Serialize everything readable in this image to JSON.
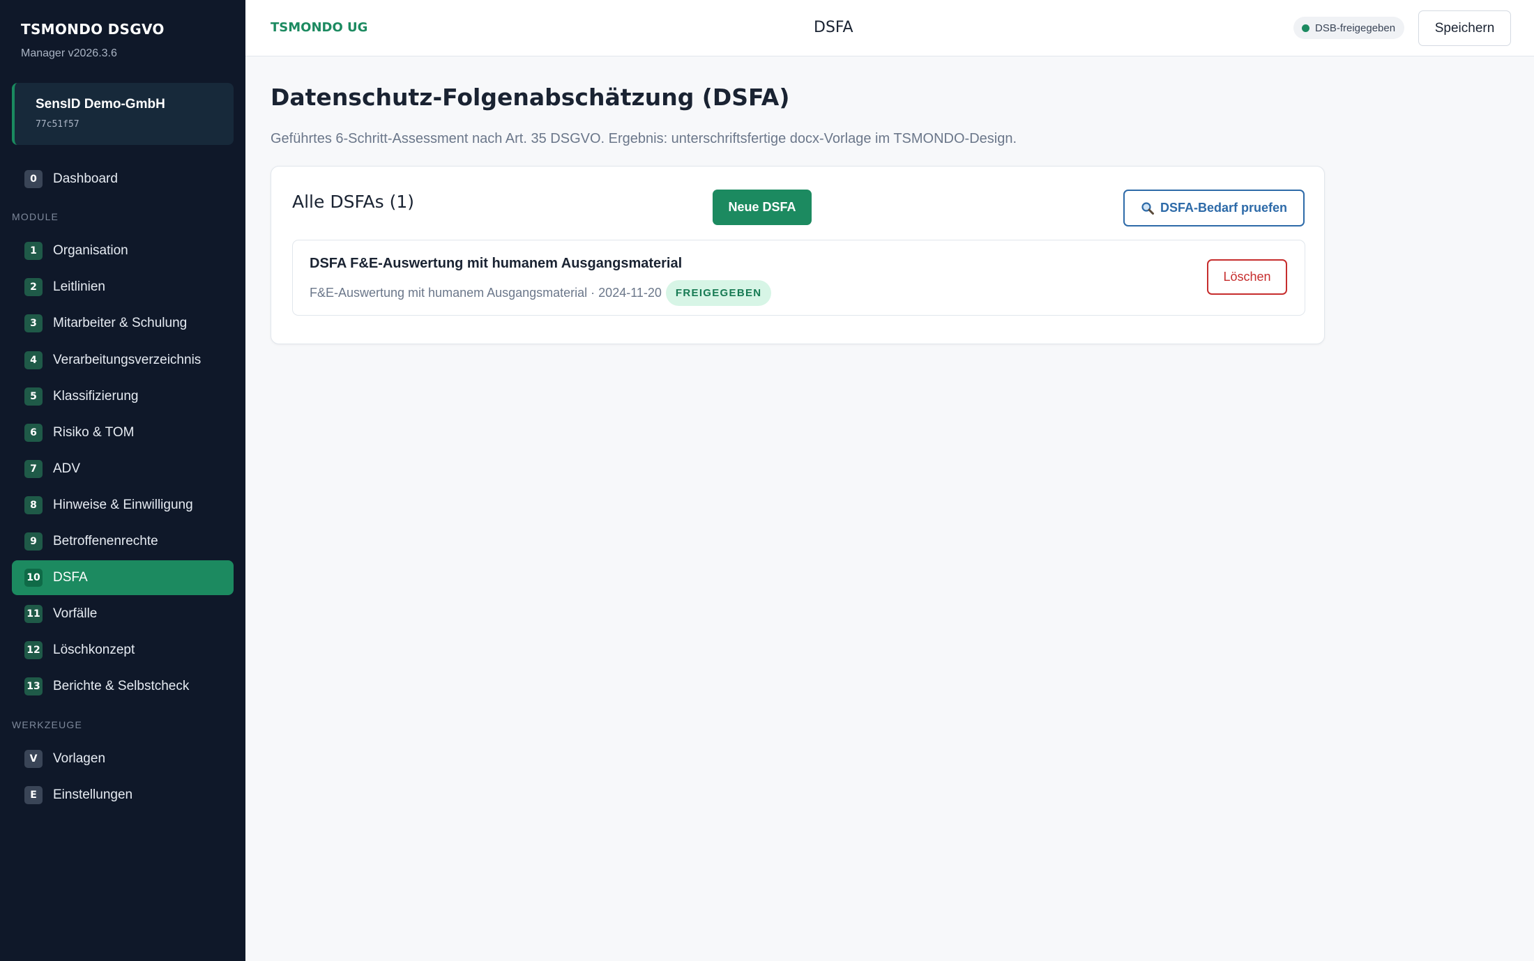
{
  "sidebar": {
    "brand": "TSMONDO DSGVO",
    "version": "Manager v2026.3.6",
    "org": {
      "name": "SensID Demo-GmbH",
      "id": "77c51f57"
    },
    "dashboard": {
      "num": "0",
      "label": "Dashboard"
    },
    "module_section": "MODULE",
    "modules": [
      {
        "num": "1",
        "label": "Organisation"
      },
      {
        "num": "2",
        "label": "Leitlinien"
      },
      {
        "num": "3",
        "label": "Mitarbeiter & Schulung"
      },
      {
        "num": "4",
        "label": "Verarbeitungsverzeichnis"
      },
      {
        "num": "5",
        "label": "Klassifizierung"
      },
      {
        "num": "6",
        "label": "Risiko & TOM"
      },
      {
        "num": "7",
        "label": "ADV"
      },
      {
        "num": "8",
        "label": "Hinweise & Einwilligung"
      },
      {
        "num": "9",
        "label": "Betroffenenrechte"
      },
      {
        "num": "10",
        "label": "DSFA",
        "active": true
      },
      {
        "num": "11",
        "label": "Vorfälle"
      },
      {
        "num": "12",
        "label": "Löschkonzept"
      },
      {
        "num": "13",
        "label": "Berichte & Selbstcheck"
      }
    ],
    "tools_section": "WERKZEUGE",
    "tools": [
      {
        "num": "V",
        "label": "Vorlagen"
      },
      {
        "num": "E",
        "label": "Einstellungen"
      }
    ]
  },
  "topbar": {
    "company": "TSMONDO UG",
    "title": "DSFA",
    "status": "DSB-freigegeben",
    "save_label": "Speichern"
  },
  "main": {
    "title": "Datenschutz-Folgenabschätzung (DSFA)",
    "description": "Geführtes 6-Schritt-Assessment nach Art. 35 DSGVO. Ergebnis: unterschriftsfertige docx-Vorlage im TSMONDO-Design.",
    "card": {
      "title": "Alle DSFAs (1)",
      "new_label": "Neue DSFA",
      "check_label": "DSFA-Bedarf pruefen",
      "items": [
        {
          "title": "DSFA F&E-Auswertung mit humanem Ausgangsmaterial",
          "meta": "F&E-Auswertung mit humanem Ausgangsmaterial · 2024-11-20",
          "badge": "FREIGEGEBEN",
          "delete_label": "Löschen"
        }
      ]
    }
  },
  "colors": {
    "accent": "#1c8a60",
    "sidebar_bg": "#0f1829",
    "link_blue": "#2d6aa8",
    "danger": "#c62d2d"
  }
}
